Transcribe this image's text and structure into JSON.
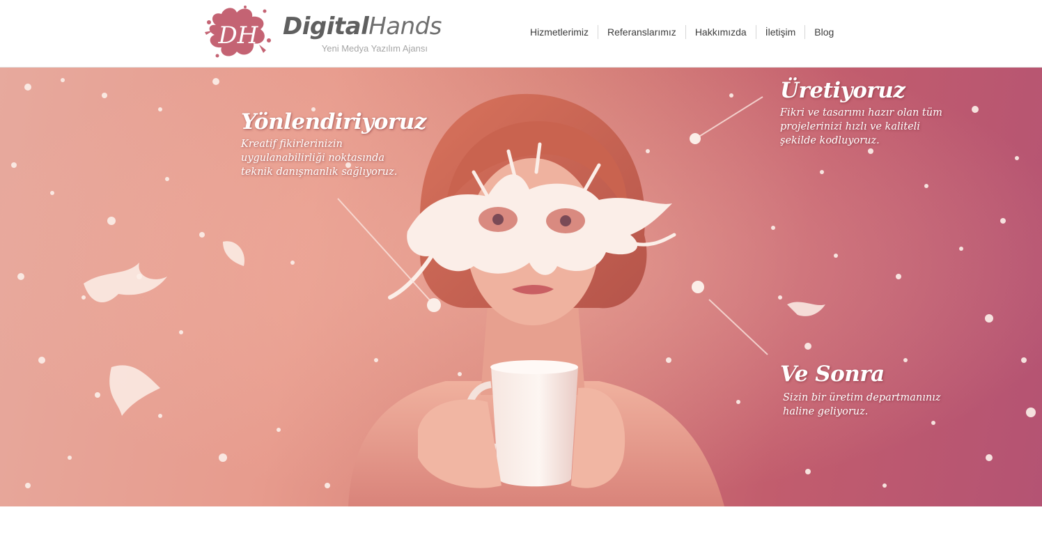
{
  "brand": {
    "initials": "DH",
    "name_first": "Digital",
    "name_second": "Hands",
    "tagline": "Yeni Medya Yazılım Ajansı",
    "color": "#c46373"
  },
  "nav": {
    "items": [
      {
        "label": "Hizmetlerimiz"
      },
      {
        "label": "Referanslarımız"
      },
      {
        "label": "Hakkımızda"
      },
      {
        "label": "İletişim"
      },
      {
        "label": "Blog"
      }
    ]
  },
  "hero": {
    "captions": [
      {
        "title": "Yönlendiriyoruz",
        "text": "Kreatif fikirlerinizin uygulanabilirliği noktasında teknik danışmanlık sağlıyoruz."
      },
      {
        "title": "Üretiyoruz",
        "text": "Fikri ve tasarımı hazır olan tüm projelerinizi hızlı ve kaliteli şekilde kodluyoruz."
      },
      {
        "title": "Ve Sonra",
        "text": "Sizin bir üretim departmanınız haline geliyoruz."
      }
    ],
    "colors": {
      "background_left": "#e7a99d",
      "background_right": "#b45373",
      "splash": "#fbeee8"
    }
  }
}
